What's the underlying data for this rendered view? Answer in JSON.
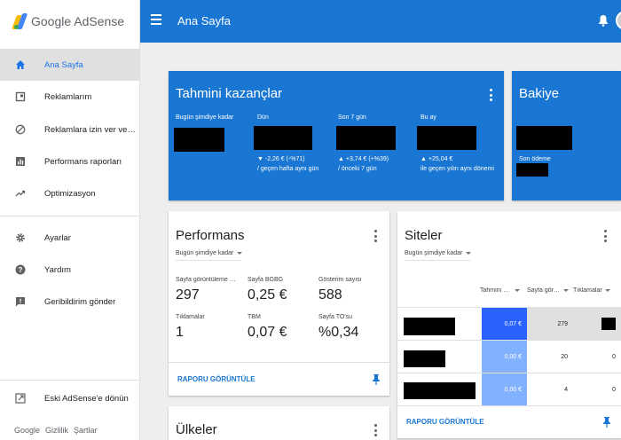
{
  "app": {
    "logo_text": "Google AdSense"
  },
  "sidebar": {
    "items": [
      {
        "label": "Ana Sayfa",
        "icon": "home-icon"
      },
      {
        "label": "Reklamlarım",
        "icon": "ads-icon"
      },
      {
        "label": "Reklamlara izin ver ve reklamları engelle",
        "icon": "block-icon"
      },
      {
        "label": "Performans raporları",
        "icon": "bar-chart-icon"
      },
      {
        "label": "Optimizasyon",
        "icon": "trending-icon"
      },
      {
        "label": "Ayarlar",
        "icon": "gear-icon"
      },
      {
        "label": "Yardım",
        "icon": "help-icon"
      },
      {
        "label": "Geribildirim gönder",
        "icon": "feedback-icon"
      },
      {
        "label": "Eski AdSense'e dönün",
        "icon": "external-link-icon"
      }
    ],
    "footer": {
      "google": "Google",
      "privacy": "Gizlilik",
      "terms": "Şartlar"
    }
  },
  "header": {
    "title": "Ana Sayfa"
  },
  "earnings": {
    "title": "Tahmini kazançlar",
    "columns": [
      {
        "label": "Bugün şimdiye kadar",
        "change_line1": "",
        "change_line2": ""
      },
      {
        "label": "Dün",
        "change_line1": "▼ -2,26 € (-%71)",
        "change_line2": "/ geçen hafta aynı gün"
      },
      {
        "label": "Son 7 gün",
        "change_line1": "▲ +3,74 € (+%39)",
        "change_line2": "/ önceki 7 gün"
      },
      {
        "label": "Bu ay",
        "change_line1": "▲ +25,04 €",
        "change_line2": "ile geçen yılın aynı dönemi"
      }
    ]
  },
  "balance": {
    "title": "Bakiye",
    "last_payment_label": "Son ödeme"
  },
  "performance": {
    "title": "Performans",
    "range": "Bugün şimdiye kadar",
    "metrics": [
      {
        "label": "Sayfa görüntüleme sayısı",
        "value": "297"
      },
      {
        "label": "Sayfa BGBG",
        "value": "0,25 €"
      },
      {
        "label": "Gösterim sayısı",
        "value": "588"
      },
      {
        "label": "Tıklamalar",
        "value": "1"
      },
      {
        "label": "TBM",
        "value": "0,07 €"
      },
      {
        "label": "Sayfa TO'su",
        "value": "%0,34"
      }
    ],
    "report_link": "RAPORU GÖRÜNTÜLE"
  },
  "sites": {
    "title": "Siteler",
    "range": "Bugün şimdiye kadar",
    "columns": [
      "Tahmini kazançlar",
      "Sayfa görüntüleme",
      "Tıklamalar"
    ],
    "rows": [
      {
        "earnings": "0,07 €",
        "pageviews": "279",
        "clicks": ""
      },
      {
        "earnings": "0,00 €",
        "pageviews": "20",
        "clicks": "0"
      },
      {
        "earnings": "0,00 €",
        "pageviews": "4",
        "clicks": "0"
      }
    ],
    "report_link": "RAPORU GÖRÜNTÜLE"
  },
  "countries": {
    "title": "Ülkeler"
  },
  "colors": {
    "primary": "#1976d2",
    "highlight": "#2962ff",
    "highlight_light": "#82b1ff"
  }
}
